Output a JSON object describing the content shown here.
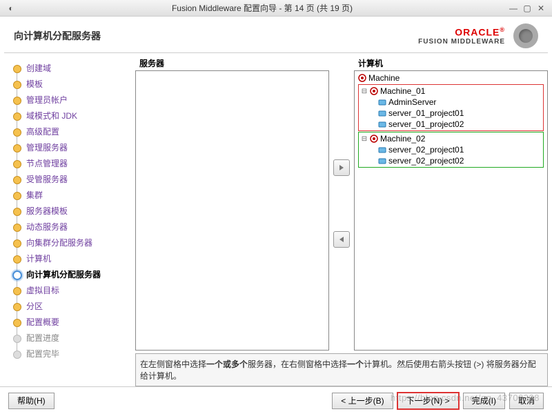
{
  "window": {
    "title": "Fusion Middleware 配置向导 - 第 14 页 (共 19 页)"
  },
  "header": {
    "page_title": "向计算机分配服务器",
    "brand": "ORACLE",
    "brand_sub": "FUSION MIDDLEWARE"
  },
  "steps": [
    {
      "label": "创建域",
      "state": "done"
    },
    {
      "label": "模板",
      "state": "done"
    },
    {
      "label": "管理员帐户",
      "state": "done"
    },
    {
      "label": "域模式和 JDK",
      "state": "done"
    },
    {
      "label": "高级配置",
      "state": "done"
    },
    {
      "label": "管理服务器",
      "state": "done"
    },
    {
      "label": "节点管理器",
      "state": "done"
    },
    {
      "label": "受管服务器",
      "state": "done"
    },
    {
      "label": "集群",
      "state": "done"
    },
    {
      "label": "服务器模板",
      "state": "done"
    },
    {
      "label": "动态服务器",
      "state": "done"
    },
    {
      "label": "向集群分配服务器",
      "state": "done"
    },
    {
      "label": "计算机",
      "state": "done"
    },
    {
      "label": "向计算机分配服务器",
      "state": "current"
    },
    {
      "label": "虚拟目标",
      "state": "done"
    },
    {
      "label": "分区",
      "state": "done"
    },
    {
      "label": "配置概要",
      "state": "done"
    },
    {
      "label": "配置进度",
      "state": "dim"
    },
    {
      "label": "配置完毕",
      "state": "dim"
    }
  ],
  "panels": {
    "left_title": "服务器",
    "right_title": "计算机"
  },
  "tree": {
    "root": "Machine",
    "machine1": {
      "name": "Machine_01",
      "servers": [
        "AdminServer",
        "server_01_project01",
        "server_01_project02"
      ]
    },
    "machine2": {
      "name": "Machine_02",
      "servers": [
        "server_02_project01",
        "server_02_project02"
      ]
    }
  },
  "instruction": {
    "p1": "在左侧窗格中选择",
    "b1": "一个或多个",
    "p2": "服务器，在右侧窗格中选择",
    "b2": "一个",
    "p3": "计算机。然后使用右箭头按钮 (>) 将服务器分配给计算机。"
  },
  "buttons": {
    "help": "帮助(H)",
    "back": "< 上一步(B)",
    "next": "下一步(N) >",
    "finish": "完成(I)",
    "cancel": "取消"
  },
  "watermark": "https://blog.csdn.net/qq_43700328"
}
